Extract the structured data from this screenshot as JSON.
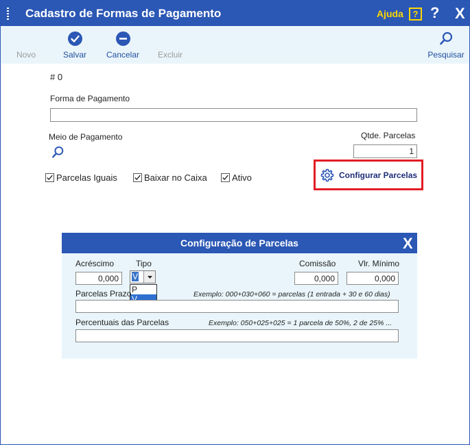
{
  "window": {
    "title": "Cadastro de Formas de Pagamento",
    "help_label": "Ajuda",
    "help_icon_text": "?",
    "question_icon_text": "?",
    "close_icon_text": "X"
  },
  "toolbar": {
    "novo": "Novo",
    "salvar": "Salvar",
    "cancelar": "Cancelar",
    "excluir": "Excluir",
    "pesquisar": "Pesquisar"
  },
  "form": {
    "record_id": "# 0",
    "forma_label": "Forma de Pagamento",
    "forma_value": "",
    "meio_label": "Meio de Pagamento",
    "qtde_label": "Qtde. Parcelas",
    "qtde_value": "1",
    "check_parcelas_iguais": "Parcelas Iguais",
    "check_baixar_caixa": "Baixar no Caixa",
    "check_ativo": "Ativo",
    "config_button": "Configurar Parcelas"
  },
  "dialog": {
    "title": "Configuração de Parcelas",
    "close_text": "X",
    "acrescimo_label": "Acréscimo",
    "acrescimo_value": "0,000",
    "tipo_label": "Tipo",
    "tipo_value": "V",
    "tipo_options": [
      "P",
      "V"
    ],
    "comissao_label": "Comissão",
    "comissao_value": "0,000",
    "vlr_minimo_label": "Vlr. Mínimo",
    "vlr_minimo_value": "0,000",
    "parcelas_prazo_label": "Parcelas Prazo",
    "parcelas_prazo_hint": "Exemplo: 000+030+060 = parcelas (1 entrada + 30 e 60 dias)",
    "parcelas_prazo_value": "",
    "percentuais_label": "Percentuais das Parcelas",
    "percentuais_hint": "Exemplo: 050+025+025 = 1 parcela de 50%, 2 de 25% ...",
    "percentuais_value": ""
  },
  "colors": {
    "titlebar": "#2b57b5",
    "toolbar_bg": "#eaf5fb",
    "accent_yellow": "#ffd800",
    "highlight_red": "#e21c23"
  }
}
